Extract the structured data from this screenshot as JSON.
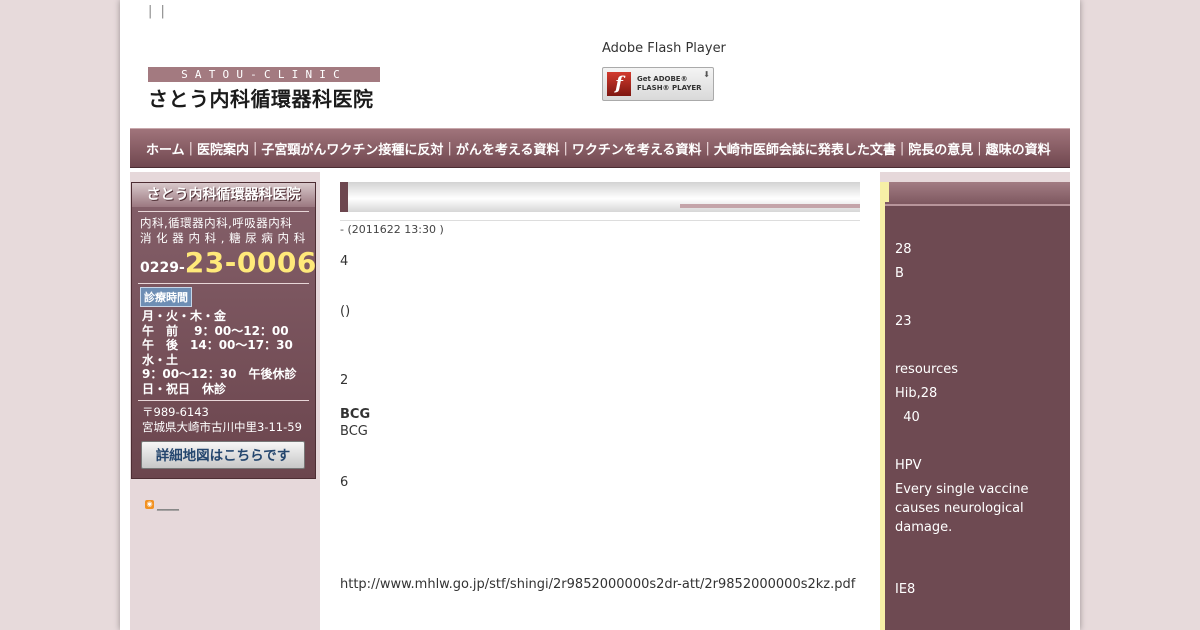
{
  "header": {
    "top_links": "| |",
    "logo_en": "SATOU-CLINIC",
    "logo_jp": "さとう内科循環器科医院",
    "flash_label": "Adobe Flash Player",
    "flash_badge_line1": "Get ADOBE®",
    "flash_badge_line2": "FLASH® PLAYER"
  },
  "nav": {
    "items": [
      {
        "label": "ホーム"
      },
      {
        "label": "医院案内"
      },
      {
        "label": "子宮頸がんワクチン接種に反対"
      },
      {
        "label": "がんを考える資料"
      },
      {
        "label": "ワクチンを考える資料"
      },
      {
        "label": "大崎市医師会誌に発表した文書"
      },
      {
        "label": "院長の意見"
      },
      {
        "label": "趣味の資料"
      }
    ],
    "separator": "|"
  },
  "sidebar": {
    "clinic_name": "さとう内科循環器科医院",
    "departments": [
      "内科,循環器内科,呼吸器内科",
      "消 化 器 内 科 , 糖 尿 病 内 科"
    ],
    "tel_area": "0229-",
    "tel_number": "23-0006",
    "hours_badge": "診療時間",
    "hours": [
      "月・火・木・金",
      "午　前　 9：00〜12：00",
      "午　後　14：00〜17：30",
      "水・土",
      "9：00〜12：30　午後休診",
      "日・祝日　休診"
    ],
    "postal": "〒989-6143",
    "address": "宮城県大崎市古川中里3-11-59",
    "map_button": "詳細地図はこちらです",
    "rss_label": "____"
  },
  "entry": {
    "meta": "-  (2011622 13:30  )",
    "paragraphs": [
      {
        "text": "4",
        "gap": 0,
        "bold": false
      },
      {
        "text": "()",
        "gap": 33,
        "bold": false
      },
      {
        "text": "2",
        "gap": 52,
        "bold": false
      },
      {
        "text": "BCG",
        "gap": 17,
        "bold": true
      },
      {
        "text": "BCG",
        "gap": 0,
        "bold": false
      },
      {
        "text": "6",
        "gap": 34,
        "bold": false
      },
      {
        "text": "http://www.mhlw.go.jp/stf/shingi/2r9852000000s2dr-att/2r9852000000s2kz.pdf",
        "gap": 85,
        "bold": false
      }
    ]
  },
  "right_sidebar": {
    "lines": [
      {
        "text": "28",
        "gap": 0
      },
      {
        "text": "B",
        "gap": 5
      },
      {
        "text": "23",
        "gap": 29
      },
      {
        "text": "resources",
        "gap": 29
      },
      {
        "text": "Hib,28",
        "gap": 5
      },
      {
        "text": "  40",
        "gap": 5
      },
      {
        "text": "HPV",
        "gap": 29
      },
      {
        "text": "Every single vaccine causes neurological damage.",
        "gap": 5
      },
      {
        "text": "IE8",
        "gap": 43
      }
    ]
  }
}
